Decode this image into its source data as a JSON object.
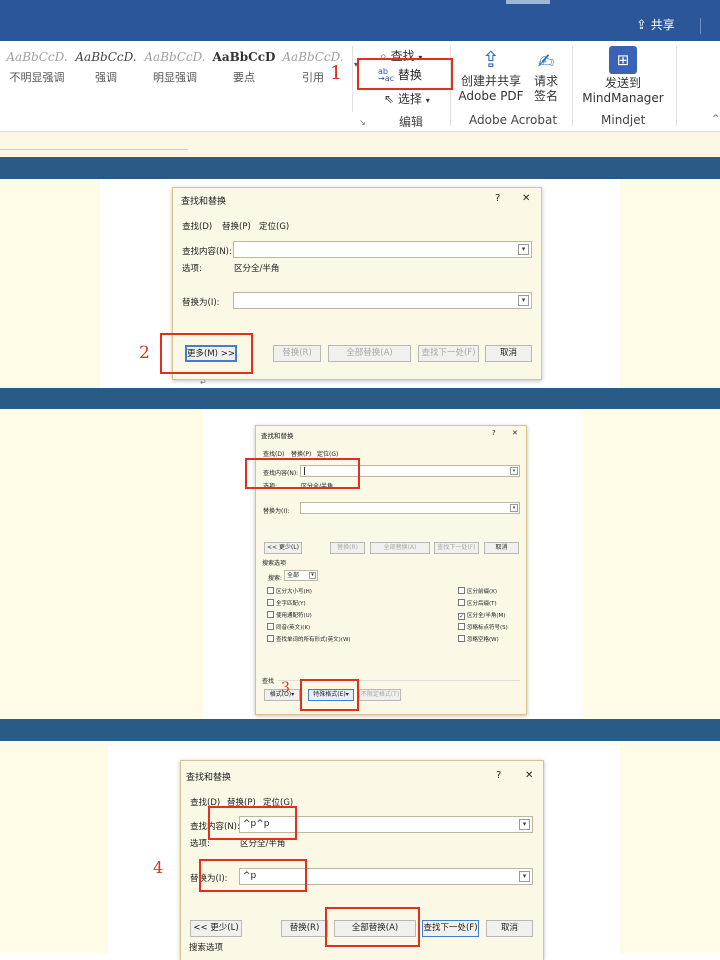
{
  "ribbon": {
    "share_label": "共享",
    "styles": [
      {
        "sample": "AaBbCcD.",
        "name": "不明显强调",
        "italic": true,
        "color": "#a0a0a0"
      },
      {
        "sample": "AaBbCcD.",
        "name": "强调",
        "italic": true,
        "color": "#444"
      },
      {
        "sample": "AaBbCcD.",
        "name": "明显强调",
        "italic": true,
        "color": "#a0a0a0"
      },
      {
        "sample": "AaBbCcD",
        "name": "要点",
        "italic": false,
        "color": "#333"
      },
      {
        "sample": "AaBbCcD.",
        "name": "引用",
        "italic": true,
        "color": "#a0a0a0"
      }
    ],
    "edit_group": {
      "find": "查找",
      "replace": "替换",
      "select": "选择",
      "label": "编辑"
    },
    "acrobat": {
      "create_share_1": "创建并共享",
      "create_share_2": "Adobe PDF",
      "request_sign_1": "请求",
      "request_sign_2": "签名",
      "label": "Adobe Acrobat"
    },
    "mindjet": {
      "send_1": "发送到",
      "send_2": "MindManager",
      "label": "Mindjet"
    }
  },
  "annotations": {
    "n1": "1",
    "n2": "2",
    "n3": "3",
    "n4": "4"
  },
  "dialog": {
    "title": "查找和替换",
    "help": "?",
    "close": "✕",
    "tabs": [
      "查找(D)",
      "替换(P)",
      "定位(G)"
    ],
    "find_label": "查找内容(N):",
    "options_label": "选项:",
    "options_value": "区分全/半角",
    "replace_label": "替换为(I):",
    "more_btn": "更多(M) >>",
    "less_btn": "<< 更少(L)",
    "replace_btn": "替换(R)",
    "replace_all_btn": "全部替换(A)",
    "find_next_btn": "查找下一处(F)",
    "cancel_btn": "取消",
    "search_options": "搜索选项",
    "search_label": "搜索:",
    "search_value": "全部",
    "left_checks": [
      "区分大小写(H)",
      "全字匹配(Y)",
      "使用通配符(U)",
      "同音(英文)(K)",
      "查找单词的所有形式(英文)(W)"
    ],
    "right_checks": [
      "区分前缀(X)",
      "区分后缀(T)",
      "区分全/半角(M)",
      "忽略标点符号(S)",
      "忽略空格(W)"
    ],
    "find_section": "查找",
    "format_btn": "格式(O)",
    "special_btn": "特殊格式(E)",
    "no_format_btn": "不限定格式(T)",
    "find_value_4": "^p^p",
    "replace_value_4": "^p"
  }
}
